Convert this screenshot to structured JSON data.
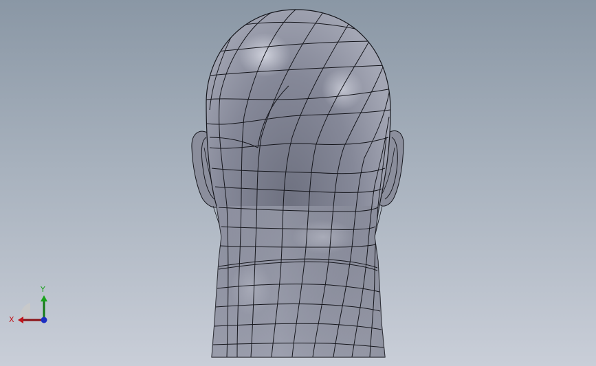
{
  "viewport": {
    "view": "back",
    "model": "head-mesh",
    "background_top": "#8a97a5",
    "background_bottom": "#c9ced8",
    "model_color": "#8c8f9c",
    "edge_color": "#15161c"
  },
  "triad": {
    "x_label": "X",
    "y_label": "Y",
    "x_color": "#c0141b",
    "y_color": "#19a21c",
    "z_color": "#1d2fc2"
  }
}
